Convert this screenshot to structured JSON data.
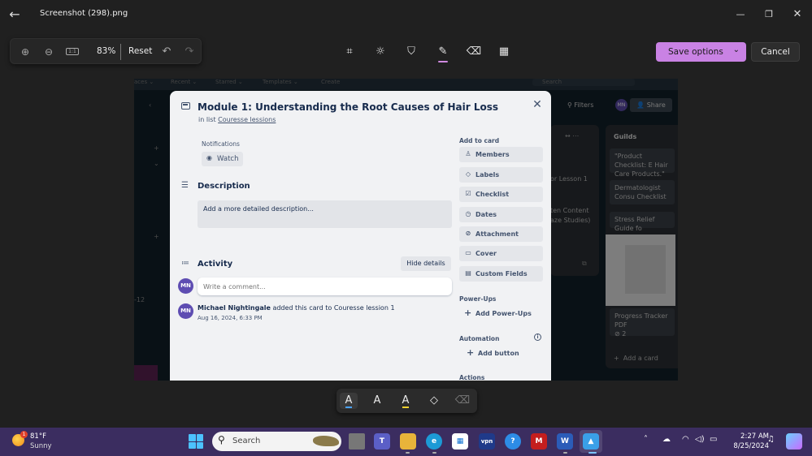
{
  "window": {
    "title": "Screenshot (298).png",
    "back_icon": "arrow-left-icon",
    "minimize_icon": "minimize-icon",
    "maximize_icon": "maximize-icon",
    "close_icon": "close-icon"
  },
  "zoom": {
    "fit_label": "1:1",
    "percent": "83%",
    "reset_label": "Reset"
  },
  "editor": {
    "save_label": "Save options",
    "cancel_label": "Cancel",
    "accent_color": "#c982e4",
    "active_tool": "markup"
  },
  "background_board": {
    "top_nav": [
      "aces ⌄",
      "Recent ⌄",
      "Starred ⌄",
      "Templates ⌄",
      "Create"
    ],
    "search_placeholder": "Search",
    "filters_label": "Filters",
    "avatar": "MN",
    "share_label": "Share",
    "list_header": "Guilds",
    "partial_cards": [
      "or Lesson 1",
      "ten Content",
      "aze Studies)"
    ],
    "guild_cards": [
      "\"Product Checklist: E Hair Care Products.\"",
      "Dermatologist Consu Checklist",
      "Stress Relief Guide fo",
      "Progress Tracker PDF"
    ],
    "attachment_count": "2",
    "add_card_label": "Add a card",
    "left_number": "-12"
  },
  "card": {
    "title": "Module 1: Understanding the Root Causes of Hair Loss",
    "list_prefix": "in list",
    "list_name": "Couresse lessions",
    "notifications_label": "Notifications",
    "watch_label": "Watch",
    "description_heading": "Description",
    "description_placeholder": "Add a more detailed description...",
    "activity_heading": "Activity",
    "hide_details_label": "Hide details",
    "user_initials": "MN",
    "comment_placeholder": "Write a comment...",
    "activity": {
      "user": "Michael Nightingale",
      "action": "added this card to Couresse lession 1",
      "time": "Aug 16, 2024, 6:33 PM"
    },
    "sidebar": {
      "add_to_card_label": "Add to card",
      "add_to_card": [
        {
          "label": "Members",
          "icon": "person-icon"
        },
        {
          "label": "Labels",
          "icon": "tag-icon"
        },
        {
          "label": "Checklist",
          "icon": "checkbox-icon"
        },
        {
          "label": "Dates",
          "icon": "clock-icon"
        },
        {
          "label": "Attachment",
          "icon": "paperclip-icon"
        },
        {
          "label": "Cover",
          "icon": "cover-icon"
        },
        {
          "label": "Custom Fields",
          "icon": "fields-icon"
        }
      ],
      "powerups_label": "Power-Ups",
      "add_powerups_label": "Add Power-Ups",
      "automation_label": "Automation",
      "add_button_label": "Add button",
      "actions_label": "Actions"
    }
  },
  "taskbar": {
    "weather_temp": "81°F",
    "weather_condition": "Sunny",
    "weather_badge": "1",
    "search_label": "Search",
    "clock_time": "2:27 AM",
    "clock_date": "8/25/2024"
  }
}
